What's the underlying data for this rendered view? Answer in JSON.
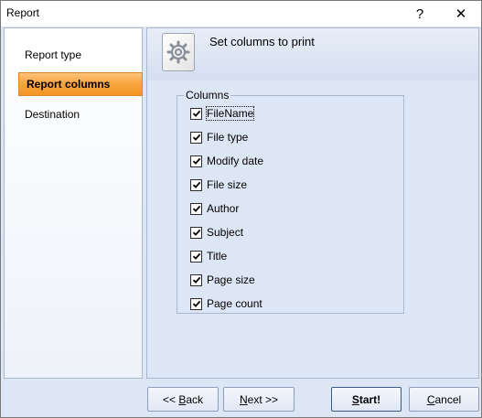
{
  "window": {
    "title": "Report",
    "help_glyph": "?",
    "close_glyph": "✕"
  },
  "nav": {
    "items": [
      {
        "label": "Report type",
        "selected": false
      },
      {
        "label": "Report columns",
        "selected": true
      },
      {
        "label": "Destination",
        "selected": false
      }
    ]
  },
  "header": {
    "title": "Set columns to print",
    "icon": "gear-page-icon"
  },
  "columns": {
    "group_label": "Columns",
    "items": [
      {
        "label": "FileName",
        "checked": true
      },
      {
        "label": "File type",
        "checked": true
      },
      {
        "label": "Modify date",
        "checked": true
      },
      {
        "label": "File size",
        "checked": true
      },
      {
        "label": "Author",
        "checked": true
      },
      {
        "label": "Subject",
        "checked": true
      },
      {
        "label": "Title",
        "checked": true
      },
      {
        "label": "Page size",
        "checked": true
      },
      {
        "label": "Page count",
        "checked": true
      }
    ]
  },
  "buttons": {
    "back_prefix": "<< ",
    "back_accel": "B",
    "back_rest": "ack",
    "next_accel": "N",
    "next_rest": "ext >>",
    "start_accel": "S",
    "start_rest": "tart!",
    "cancel_accel": "C",
    "cancel_rest": "ancel"
  },
  "colors": {
    "selection": "#f8a33e",
    "pane_bg": "#dde6f4",
    "border": "#a9b7cf"
  }
}
